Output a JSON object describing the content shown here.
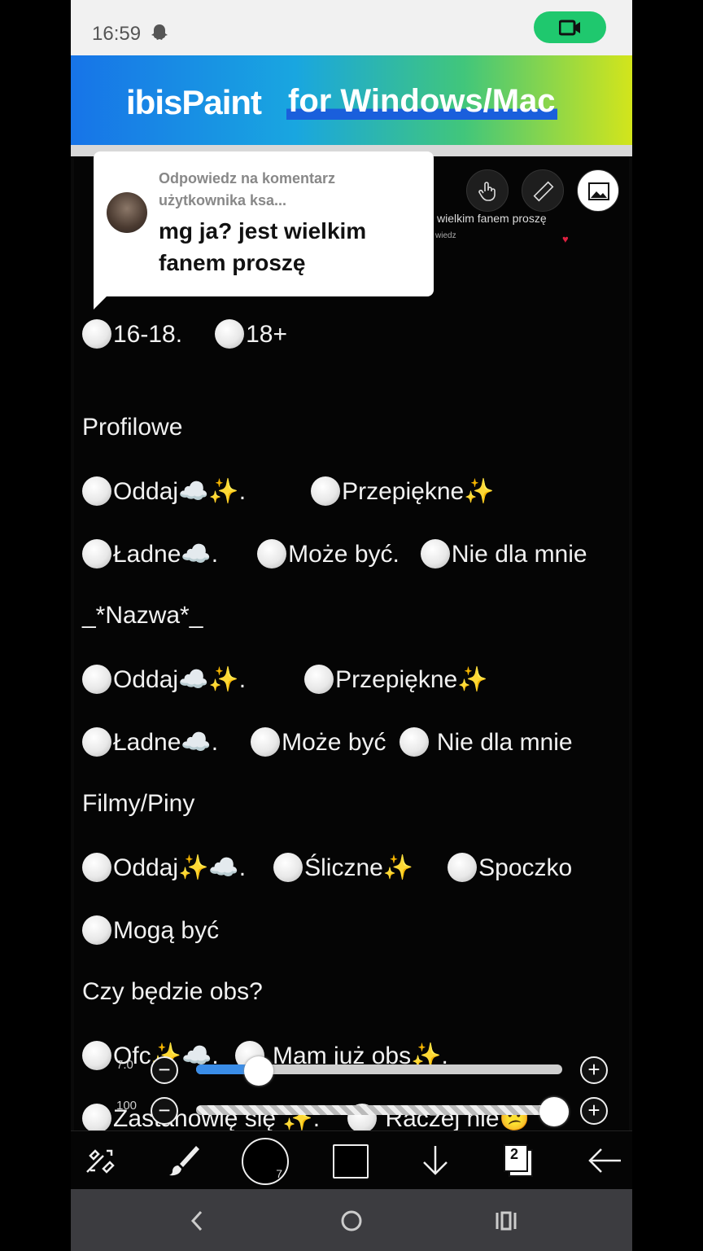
{
  "status_bar": {
    "time": "16:59"
  },
  "banner": {
    "logo": "ibisPaint",
    "tagline": "for Windows/Mac"
  },
  "canvas_overlay": {
    "caption": "wielkim fanem proszę",
    "fragment": "wiedz"
  },
  "comment_bubble": {
    "meta": "Odpowiedz na komentarz użytkownika ksa...",
    "text": "mg ja? jest wielkim fanem proszę"
  },
  "content_lines": [
    {
      "options": [
        "16-18.",
        "18+"
      ]
    },
    {
      "heading": "Profilowe"
    },
    {
      "options": [
        "Oddaj☁️✨.",
        "Przepiękne✨"
      ]
    },
    {
      "options": [
        "Ładne☁️.",
        "Może być.",
        "Nie dla mnie"
      ]
    },
    {
      "heading": "_*Nazwa*_"
    },
    {
      "options": [
        "Oddaj☁️✨.",
        "Przepiękne✨"
      ]
    },
    {
      "options": [
        "Ładne☁️.",
        "Może być",
        " Nie dla mnie"
      ]
    },
    {
      "heading": "Filmy/Piny"
    },
    {
      "options": [
        "Oddaj✨☁️.",
        "Śliczne✨",
        "Spoczko"
      ]
    },
    {
      "options": [
        "Mogą być"
      ]
    },
    {
      "heading": "Czy będzie obs?"
    },
    {
      "options": [
        "Ofc✨☁️.",
        " Mam już obs✨."
      ]
    },
    {
      "options": [
        "Zastanowię się ✨.",
        " Raczej nie😕"
      ]
    }
  ],
  "sliders": {
    "brush_size": {
      "value_label": "7.0",
      "fraction": 0.17
    },
    "opacity": {
      "value_label": "100",
      "fraction": 1.0
    }
  },
  "toolbar": {
    "brush_size_badge": "7",
    "layer_count": "2"
  },
  "colors": {
    "accent": "#1fc86e",
    "slider_fill": "#3a8de8",
    "background": "#050505"
  },
  "icons": [
    "snapchat-ghost-icon",
    "screen-record-icon",
    "hand-icon",
    "ruler-icon",
    "image-icon",
    "transform-tool-icon",
    "brush-icon",
    "download-icon",
    "back-arrow-icon",
    "nav-back-icon",
    "nav-home-icon",
    "nav-recents-icon"
  ]
}
